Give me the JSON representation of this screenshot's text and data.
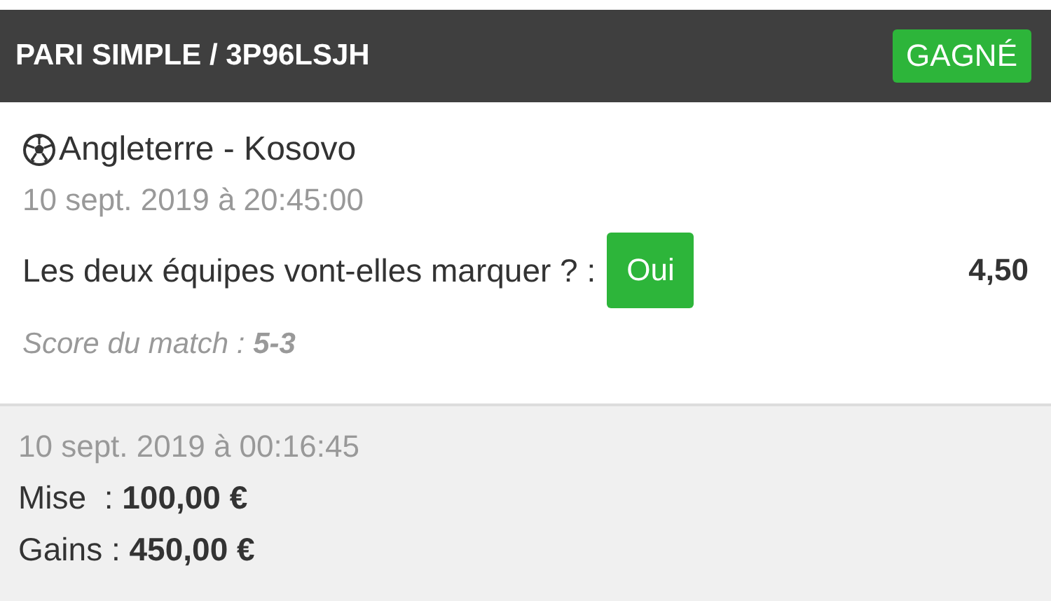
{
  "header": {
    "title": "PARI SIMPLE / 3P96LSJH",
    "status": {
      "label": "GAGNÉ",
      "kind": "won"
    }
  },
  "selection": {
    "match": "Angleterre - Kosovo",
    "date": "10 sept. 2019 à 20:45:00",
    "question": "Les deux équipes vont-elles marquer ? :",
    "pick": "Oui",
    "odds": "4,50",
    "score": "Score du match : **5-3**"
  },
  "summary": {
    "date": "10 sept. 2019 à 00:16:45",
    "lines": [
      "Mise  : **100,00 €**",
      "Gains : **450,00 €**"
    ]
  }
}
